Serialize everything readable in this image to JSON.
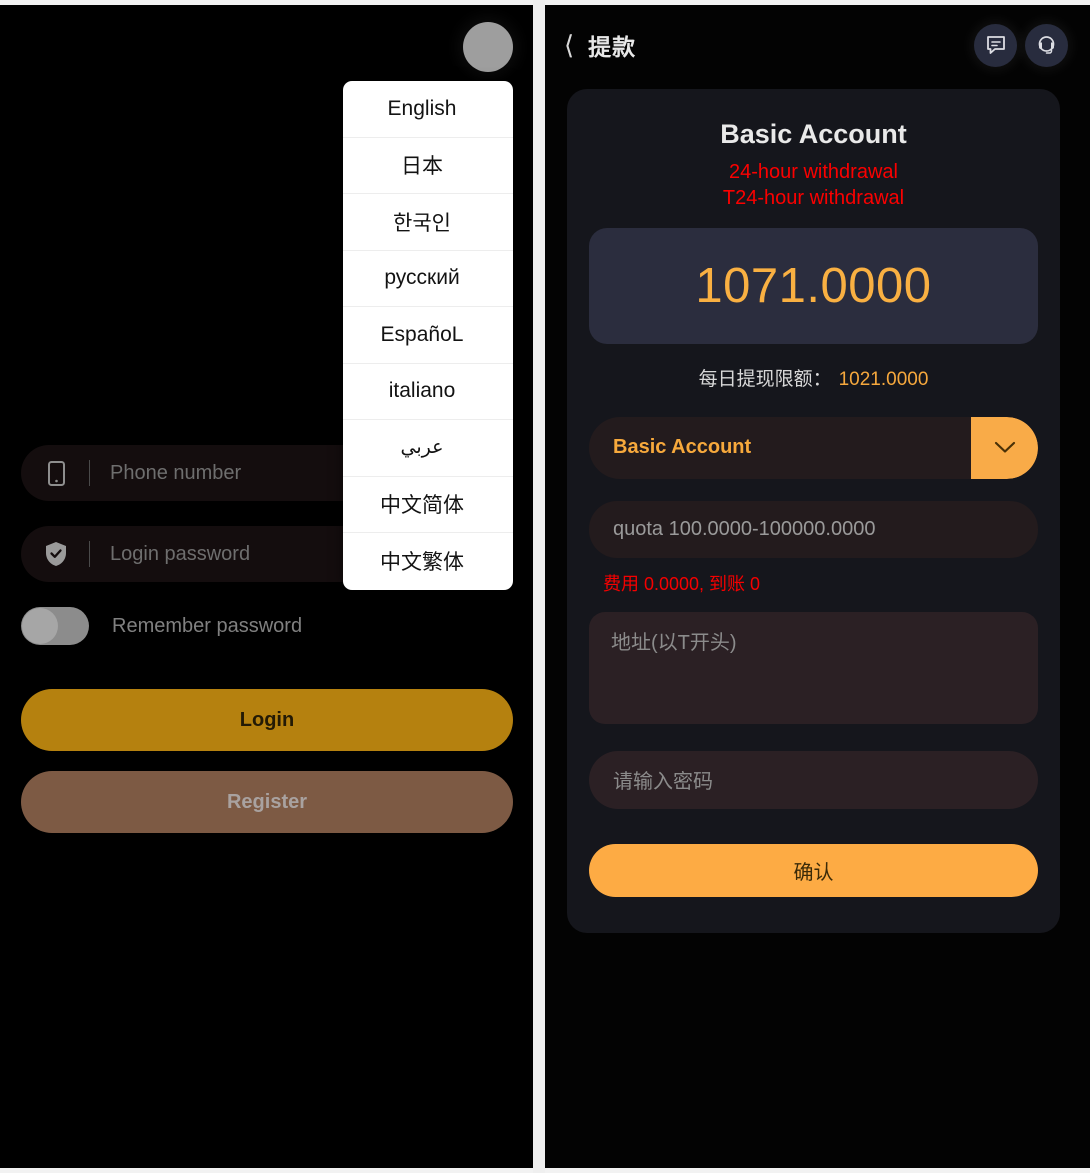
{
  "login_panel": {
    "avatar_icon": "avatar-placeholder-icon",
    "language_menu": {
      "items": [
        {
          "label": "English"
        },
        {
          "label": "日本"
        },
        {
          "label": "한국인"
        },
        {
          "label": "русский"
        },
        {
          "label": "EspañoL"
        },
        {
          "label": "italiano"
        },
        {
          "label": "عربي"
        },
        {
          "label": "中文简体"
        },
        {
          "label": "中文繁体"
        }
      ]
    },
    "phone_field": {
      "icon": "phone-icon",
      "placeholder": "Phone number",
      "value": ""
    },
    "password_field": {
      "icon": "shield-check-icon",
      "placeholder": "Login password",
      "value": ""
    },
    "remember": {
      "label": "Remember password",
      "checked": false
    },
    "login_button": "Login",
    "register_button": "Register"
  },
  "withdrawal_panel": {
    "header": {
      "back_icon": "chevron-left-icon",
      "title": "提款",
      "chat_icon": "chat-bubble-icon",
      "support_icon": "headset-support-icon"
    },
    "account": {
      "title": "Basic Account",
      "note_line1": "24-hour withdrawal",
      "note_line2": "T24-hour withdrawal",
      "balance": "1071.0000",
      "daily_limit_label": "每日提现限额：",
      "daily_limit_value": "1021.0000"
    },
    "selector": {
      "value": "Basic Account",
      "arrow_icon": "chevron-down-icon"
    },
    "amount_field": {
      "placeholder": "quota 100.0000-100000.0000",
      "value": ""
    },
    "fee_line": "费用 0.0000, 到账 0",
    "address_field": {
      "placeholder": "地址(以T开头)",
      "value": ""
    },
    "password_field": {
      "placeholder": "请输入密码",
      "value": ""
    },
    "confirm_button": "确认"
  },
  "colors": {
    "accent_orange": "#f9ab48",
    "balance_orange": "#f9b042",
    "warning_red": "#fb0000",
    "login_gold": "#b5810f",
    "register_brown": "#7d5a44",
    "panel_black": "#000000",
    "card_dark": "#15161c",
    "balance_navy": "#2b2d3e"
  }
}
